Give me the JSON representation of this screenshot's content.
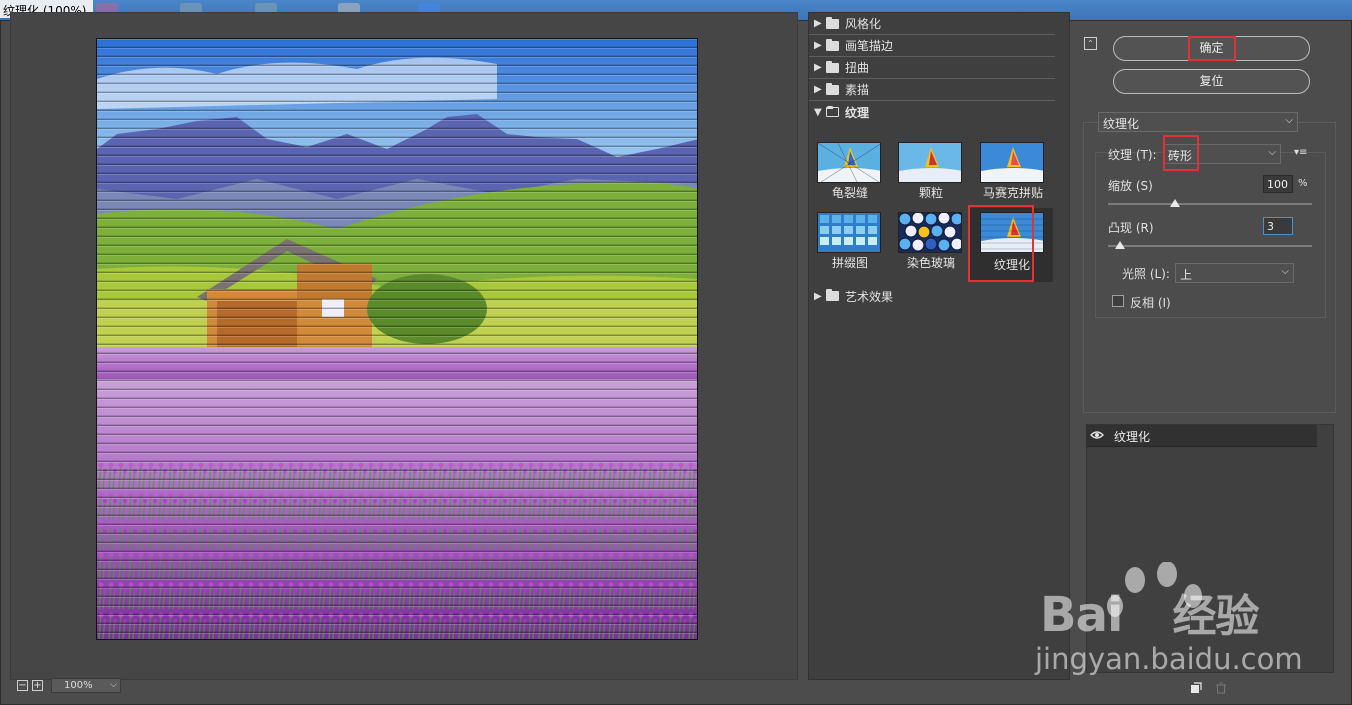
{
  "window": {
    "title": "纹理化 (100%)"
  },
  "gallery": {
    "folders_top": [
      {
        "label": "风格化"
      },
      {
        "label": "画笔描边"
      },
      {
        "label": "扭曲"
      },
      {
        "label": "素描"
      }
    ],
    "open_folder": {
      "label": "纹理"
    },
    "thumbs": [
      {
        "label": "龟裂缝"
      },
      {
        "label": "颗粒"
      },
      {
        "label": "马赛克拼贴"
      },
      {
        "label": "拼缀图"
      },
      {
        "label": "染色玻璃"
      },
      {
        "label": "纹理化"
      }
    ],
    "folder_bottom": {
      "label": "艺术效果"
    }
  },
  "buttons": {
    "ok": "确定",
    "reset": "复位"
  },
  "filter": {
    "selected": "纹理化",
    "texture_label": "纹理 (T):",
    "texture_value": "砖形",
    "scale_label": "缩放 (S)",
    "scale_value": "100",
    "scale_unit": "%",
    "scale_fraction": 0.33,
    "relief_label": "凸现 (R)",
    "relief_value": "3",
    "relief_fraction": 0.06,
    "light_label": "光照 (L):",
    "light_value": "上",
    "invert_label": "反相 (I)"
  },
  "layers": {
    "items": [
      {
        "label": "纹理化"
      }
    ]
  },
  "zoom": {
    "value": "100%",
    "minus": "−",
    "plus": "+"
  },
  "watermark": {
    "text": "Bai",
    "text2": "经验",
    "url": "jingyan.baidu.com"
  },
  "colors": {
    "accent_red": "#e03333",
    "focus_blue": "#4d8fd6",
    "panel": "#4c4c4c"
  }
}
